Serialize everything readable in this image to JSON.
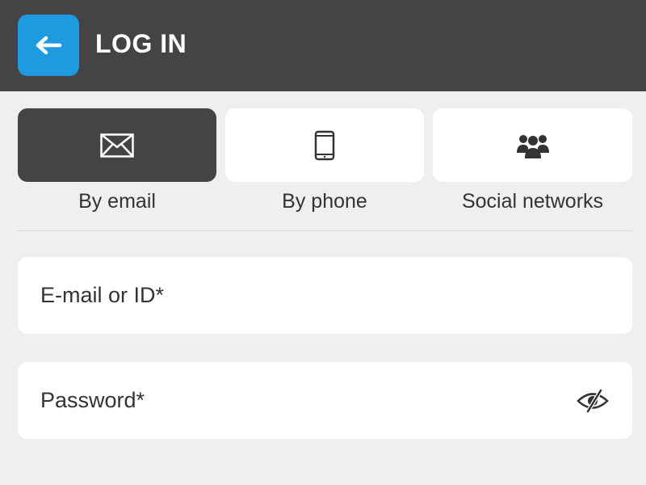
{
  "header": {
    "title": "LOG IN",
    "back_icon": "arrow-left-icon",
    "accent_color": "#1e9be0",
    "background_color": "#444444"
  },
  "login_methods": [
    {
      "label": "By email",
      "icon": "envelope-icon",
      "active": true
    },
    {
      "label": "By phone",
      "icon": "phone-icon",
      "active": false
    },
    {
      "label": "Social networks",
      "icon": "users-icon",
      "active": false
    }
  ],
  "form": {
    "email": {
      "value": "",
      "placeholder": "E-mail or ID*"
    },
    "password": {
      "value": "",
      "placeholder": "Password*",
      "toggle_icon": "eye-slash-icon"
    }
  }
}
